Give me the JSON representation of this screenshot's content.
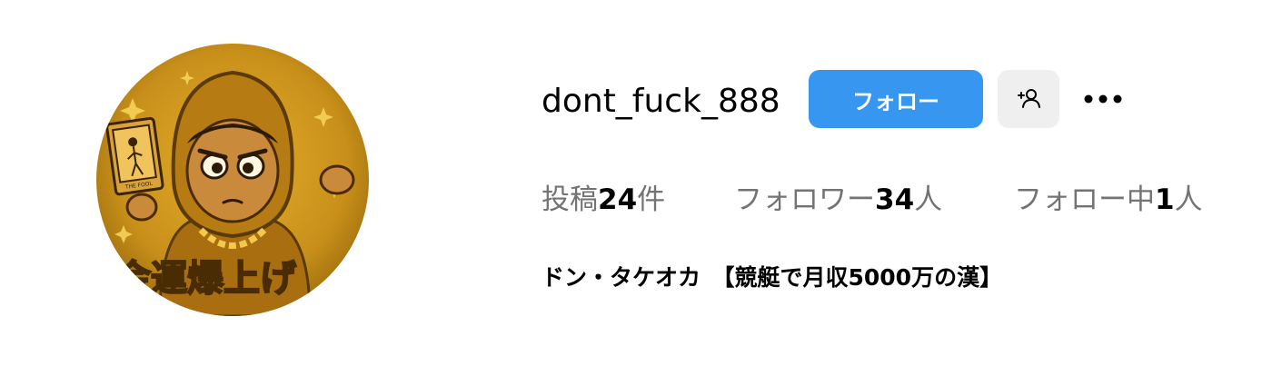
{
  "profile": {
    "username": "dont_fuck_888",
    "full_name": "ドン・タケオカ　【競艇で月収5000万の漢】",
    "avatar_icon": "hooded-character-avatar-icon",
    "avatar_card_text": "THE FOOL",
    "avatar_banner_text": "金運爆上げ"
  },
  "actions": {
    "follow_label": "フォロー",
    "suggest_icon": "add-person-icon",
    "more_icon": "more-horizontal-icon"
  },
  "stats": {
    "posts": {
      "label": "投稿",
      "count": "24",
      "suffix": "件"
    },
    "followers": {
      "label": "フォロワー",
      "count": "34",
      "suffix": "人"
    },
    "following": {
      "label": "フォロー中",
      "count": "1",
      "suffix": "人"
    }
  },
  "colors": {
    "follow_button": "#3797f0",
    "secondary_button": "#efefef",
    "muted_text": "#737373",
    "avatar_gold": "#c8901a"
  }
}
